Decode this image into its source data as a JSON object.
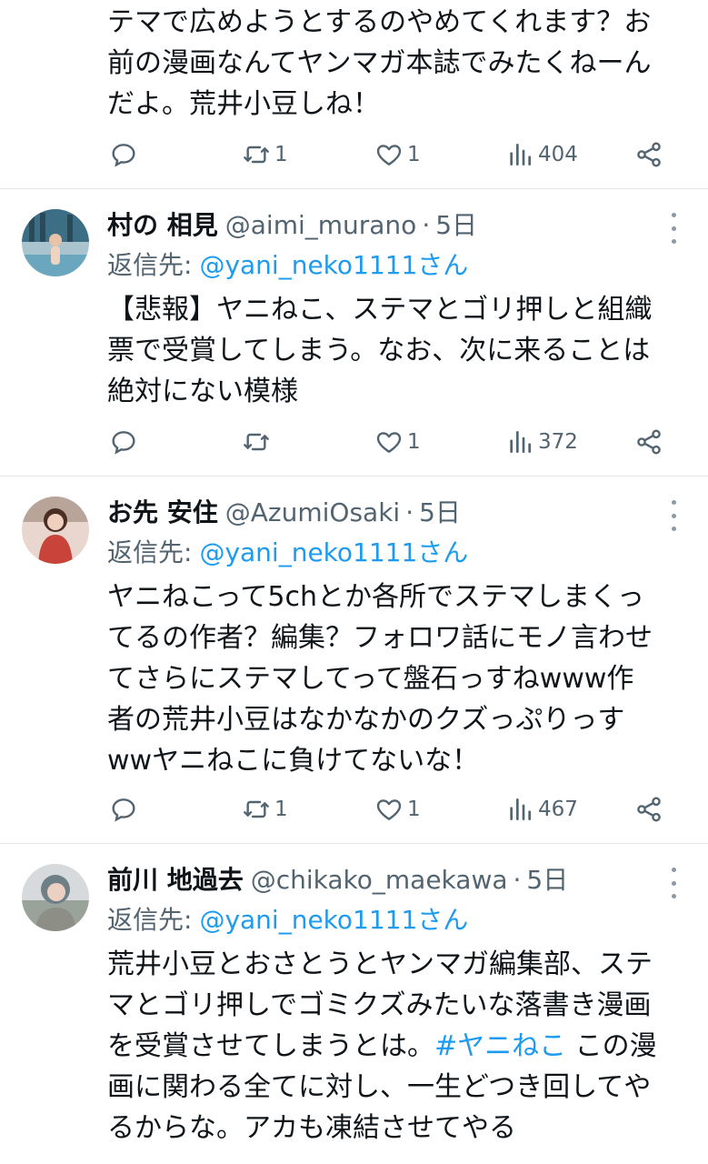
{
  "tweets": [
    {
      "body_lines": [
        "テマで広めようとするのやめてくれます？お",
        "前の漫画なんてヤンマガ本誌でみたくねーん",
        "だよ。荒井小豆しね！"
      ],
      "replies": "",
      "retweets": "1",
      "likes": "1",
      "views": "404"
    },
    {
      "name": "村の 相見",
      "handle": "@aimi_murano",
      "time": "5日",
      "reply_label": "返信先:",
      "reply_mention": "@yani_neko1111さん",
      "body_lines": [
        "【悲報】ヤニねこ、ステマとゴリ押しと組織",
        "票で受賞してしまう。なお、次に来ることは",
        "絶対にない模様"
      ],
      "replies": "",
      "retweets": "",
      "likes": "1",
      "views": "372",
      "avatar_colors": [
        "#3c6f86",
        "#a9c4cf"
      ]
    },
    {
      "name": "お先 安住",
      "handle": "@AzumiOsaki",
      "time": "5日",
      "reply_label": "返信先:",
      "reply_mention": "@yani_neko1111さん",
      "body_lines": [
        "ヤニねこって5chとか各所でステマしまくっ",
        "てるの作者？編集？フォロワ話にモノ言わせ",
        "てさらにステマしてって盤石っすねwww作",
        "者の荒井小豆はなかなかのクズっぷりっす",
        "wwヤニねこに負けてないな！"
      ],
      "replies": "",
      "retweets": "1",
      "likes": "1",
      "views": "467",
      "avatar_colors": [
        "#c8433a",
        "#e9d7cf"
      ]
    },
    {
      "name": "前川 地過去",
      "handle": "@chikako_maekawa",
      "time": "5日",
      "reply_label": "返信先:",
      "reply_mention": "@yani_neko1111さん",
      "body_line1": "荒井小豆とおさとうとヤンマガ編集部、ステ",
      "body_line2": "マとゴリ押しでゴミクズみたいな落書き漫画",
      "body_line3_pre": "を受賞させてしまうとは。",
      "body_hashtag": "#ヤニねこ",
      "body_line3_post": " この漫",
      "body_line4": "画に関わる全てに対し、一生どつき回してや",
      "body_line5": "るからな。アカも凍結させてやる",
      "avatar_colors": [
        "#6f7f86",
        "#d6dadc"
      ]
    }
  ],
  "colors": {
    "text": "#0f1419",
    "secondary": "#536471",
    "accent": "#1d9bf0",
    "divider": "#e3e6e9"
  },
  "icons": [
    "reply-icon",
    "retweet-icon",
    "like-icon",
    "views-icon",
    "share-icon",
    "more-icon"
  ]
}
